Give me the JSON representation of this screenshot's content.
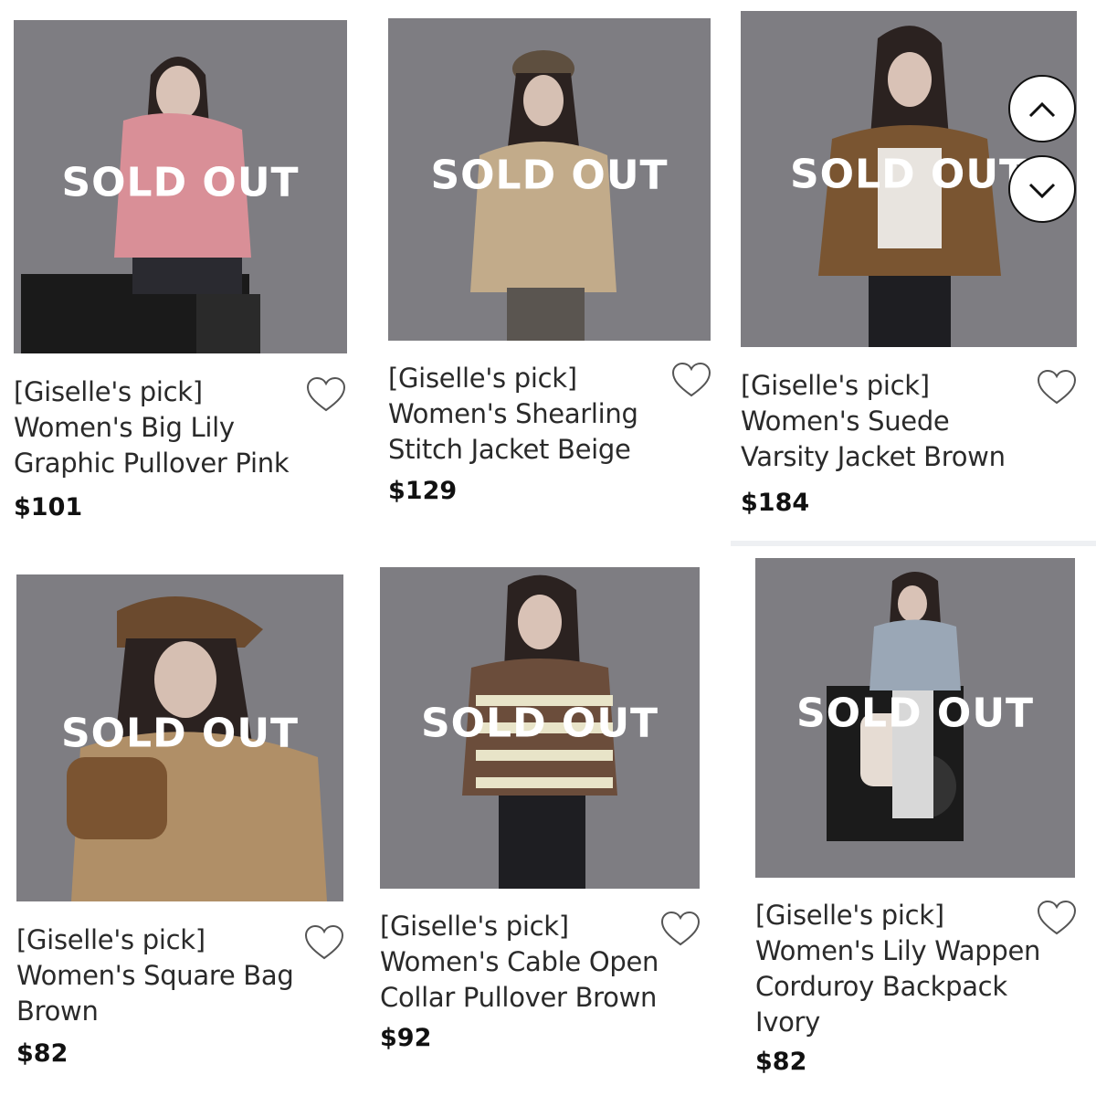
{
  "overlay_text": "SOLD OUT",
  "colors": {
    "image_bg": "#7e7d82",
    "overlay_text": "#ffffff",
    "price": "#111111"
  },
  "products": [
    {
      "lines": [
        "[Giselle's pick]",
        "Women's Big Lily",
        "Graphic Pullover Pink"
      ],
      "price": "$101",
      "status": "SOLD OUT"
    },
    {
      "lines": [
        "[Giselle's pick]",
        "Women's Shearling",
        "Stitch Jacket Beige"
      ],
      "price": "$129",
      "status": "SOLD OUT"
    },
    {
      "lines": [
        "[Giselle's pick]",
        "Women's Suede",
        "Varsity Jacket Brown"
      ],
      "price": "$184",
      "status": "SOLD OUT"
    },
    {
      "lines": [
        "[Giselle's pick]",
        "Women's Square Bag",
        "Brown"
      ],
      "price": "$82",
      "status": "SOLD OUT"
    },
    {
      "lines": [
        "[Giselle's pick]",
        "Women's Cable Open",
        "Collar Pullover Brown"
      ],
      "price": "$92",
      "status": "SOLD OUT"
    },
    {
      "lines": [
        "[Giselle's pick]",
        "Women's Lily Wappen",
        "Corduroy Backpack",
        "Ivory"
      ],
      "price": "$82",
      "status": "SOLD OUT"
    }
  ],
  "icons": {
    "wishlist": "heart-outline-icon",
    "scroll_up": "chevron-up-icon",
    "scroll_down": "chevron-down-icon"
  }
}
